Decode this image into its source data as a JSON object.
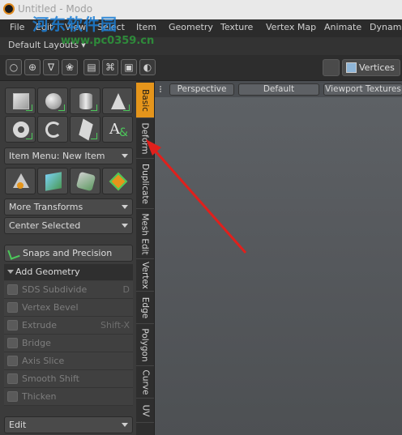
{
  "window": {
    "title": "Untitled - Modo",
    "watermark": "河东软件园",
    "watermark_url": "www.pc0359.cn"
  },
  "menubar": {
    "items": [
      "File",
      "Edit",
      "View",
      "Select",
      "Item",
      "Geometry",
      "Texture",
      "Vertex Map",
      "Animate",
      "Dynamic"
    ]
  },
  "layouts": {
    "label": "Default Layouts ▾"
  },
  "toolbar": {
    "buttons": [
      "○",
      "⊕",
      "∇",
      "❀",
      "▤",
      "⌘",
      "▣",
      "◐"
    ],
    "mode_label": "Vertices"
  },
  "left_panel": {
    "item_menu": "Item Menu: New Item",
    "more_transforms": "More Transforms",
    "center_selected": "Center Selected",
    "snaps": "Snaps and Precision",
    "add_geometry": "Add Geometry",
    "geometry_items": [
      {
        "label": "SDS Subdivide",
        "shortcut": "D"
      },
      {
        "label": "Vertex Bevel",
        "shortcut": ""
      },
      {
        "label": "Extrude",
        "shortcut": "Shift-X"
      },
      {
        "label": "Bridge",
        "shortcut": ""
      },
      {
        "label": "Axis Slice",
        "shortcut": ""
      },
      {
        "label": "Smooth Shift",
        "shortcut": ""
      },
      {
        "label": "Thicken",
        "shortcut": ""
      }
    ],
    "edit_dropdown": "Edit"
  },
  "tabs": [
    "Basic",
    "Deform",
    "Duplicate",
    "Mesh Edit",
    "Vertex",
    "Edge",
    "Polygon",
    "Curve",
    "UV"
  ],
  "viewport": {
    "buttons": [
      "Perspective",
      "Default",
      "Viewport Textures"
    ]
  },
  "colors": {
    "active_tab": "#e5951b",
    "annotation_arrow": "#e0201c",
    "accent_green": "#4cc85a"
  }
}
